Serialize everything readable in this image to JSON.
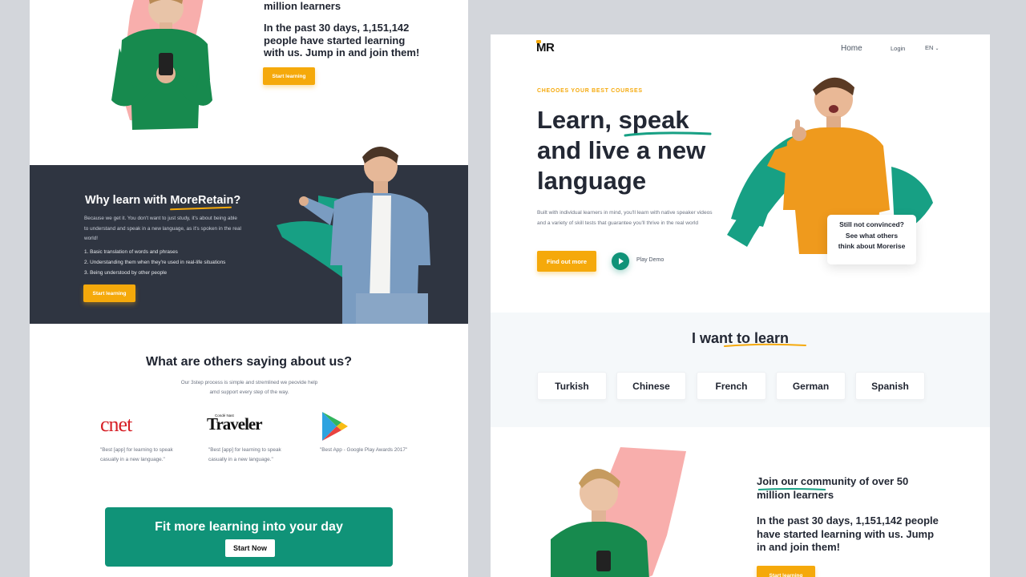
{
  "left_page": {
    "community_tail": "million learners",
    "stats_text": "In the past 30 days, 1,151,142 people have started learning with us. Jump in and join them!",
    "start_learning_1": "Start learning",
    "why": {
      "title_prefix": "Why learn with ",
      "title_brand": "MoreRetain",
      "title_suffix": "?",
      "description": "Because we get it. You don't want to just study, it's about being able to understand and speak in a new language, as it's spoken in the real world!",
      "list": [
        "1. Basic translation of words and phrases",
        "2. Understanding them when they're used in real-life situations",
        "3. Being understood by other people"
      ],
      "button": "Start learning"
    },
    "testimonials": {
      "title": "What are others saying about us?",
      "subtitle": "Our 3step process is simple and stremlined we peovide help amd support every step of the way.",
      "items": [
        {
          "logo": "cnet",
          "quote": "\"Best [app] for learning to speak casually in a new language.\""
        },
        {
          "logo": "Traveler",
          "logo_small": "Condé Nast",
          "quote": "\"Best [app] for learning to speak casually in a new language.\""
        },
        {
          "logo": "google-play-icon",
          "quote": "\"Best App - Google Play Awards 2017\""
        }
      ]
    },
    "cta": {
      "title": "Fit more learning into your day",
      "button": "Start Now"
    }
  },
  "right_page": {
    "logo": "MR",
    "nav": {
      "home": "Home",
      "login": "Login",
      "language": "EN"
    },
    "eyebrow": "CHEOOES YOUR BEST COURSES",
    "headline_l1_a": "Learn, ",
    "headline_l1_b": "speak",
    "headline_l2": "and live a new",
    "headline_l3": "language",
    "description": "Built with individual learners in mind, you'll learn with native speaker videos and a variety of skill tests that guarantee you'll thrive in the real world",
    "find_out_more": "Find out more",
    "play_demo": "Play Demo",
    "callout": [
      "Still not convinced?",
      "See what others",
      "think about Morerise"
    ],
    "learn_title": "I want to learn",
    "languages": [
      "Turkish",
      "Chinese",
      "French",
      "German",
      "Spanish"
    ],
    "community_title": "Join our community of over 50 million learners",
    "stats_text": "In the past 30 days, 1,151,142 people have started learning with us. Jump in and join them!",
    "start_learning": "Start learning"
  },
  "colors": {
    "accent_yellow": "#f5a90b",
    "accent_green": "#109378",
    "dark_panel": "#2f3541",
    "brush_pink": "#f7a5a3",
    "brush_green": "#17a084"
  }
}
